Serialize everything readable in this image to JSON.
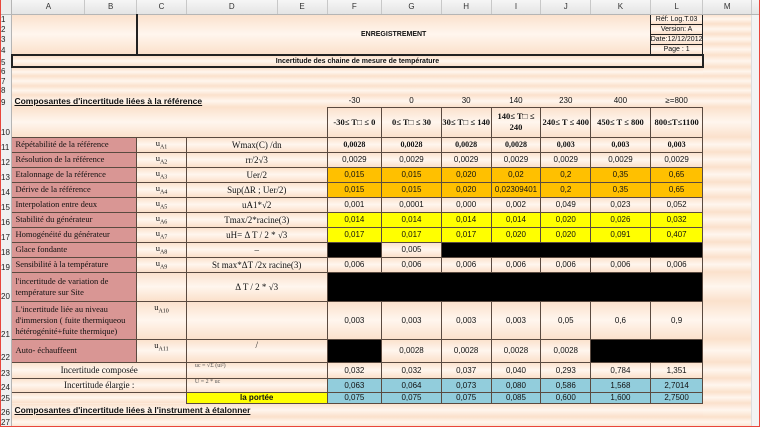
{
  "columns": [
    "A",
    "B",
    "C",
    "D",
    "E",
    "F",
    "G",
    "H",
    "I",
    "J",
    "K",
    "L",
    "M"
  ],
  "header": {
    "title": "ENREGISTREMENT",
    "subtitle": "Incertitude des chaine de mesure de température",
    "ref": "Réf: Log.T.03",
    "version": "Version: A",
    "date": "Date:12/12/2012",
    "page": "Page : 1"
  },
  "section1_title": "Composantes d'incertitude liées à la référence",
  "section2_title": "Composantes d'incertitude liées à l'instrument à étalonner",
  "temps": [
    "-30",
    "0",
    "30",
    "140",
    "230",
    "400",
    "≥=800"
  ],
  "ranges": [
    "-30≤ T□ ≤ 0",
    "0≤ T□ ≤ 30",
    "30≤ T□ ≤ 140",
    "140≤ T□ ≤ 240",
    "240≤ T ≤ 400",
    "450≤ T ≤ 800",
    "800≤T≤1100"
  ],
  "rows": [
    {
      "num": 11,
      "label": "Répétabilité de la référence",
      "symbol": "uA1",
      "formula": "Wmax(C) /dn",
      "fill": "",
      "bold": true,
      "values": [
        "0,0028",
        "0,0028",
        "0,0028",
        "0,0028",
        "0,003",
        "0,003",
        "0,003"
      ]
    },
    {
      "num": 12,
      "label": "Résolution de la  référence",
      "symbol": "uA2",
      "formula": "rr/2√3",
      "fill": "",
      "values": [
        "0,0029",
        "0,0029",
        "0,0029",
        "0,0029",
        "0,0029",
        "0,0029",
        "0,0029"
      ]
    },
    {
      "num": 13,
      "label": "Etalonnage de la référence",
      "symbol": "uA3",
      "formula": "Uer/2",
      "fill": "orange",
      "values": [
        "0,015",
        "0,015",
        "0,020",
        "0,02",
        "0,2",
        "0,35",
        "0,65"
      ]
    },
    {
      "num": 14,
      "label": "Dérive de la référence",
      "symbol": "uA4",
      "formula": "Sup(ΔR ; Uer/2)",
      "fill": "orange",
      "values": [
        "0,015",
        "0,015",
        "0,020",
        "0,02309401",
        "0,2",
        "0,35",
        "0,65"
      ]
    },
    {
      "num": 15,
      "label": "Interpolation entre deux",
      "symbol": "uA5",
      "formula": "uA1*√2",
      "fill": "",
      "values": [
        "0,001",
        "0,0001",
        "0,000",
        "0,002",
        "0,049",
        "0,023",
        "0,052"
      ]
    },
    {
      "num": 16,
      "label": "Stabilité du générateur",
      "symbol": "uA6",
      "formula": "Tmax/2*racine(3)",
      "fill": "yellow",
      "values": [
        "0,014",
        "0,014",
        "0,014",
        "0,014",
        "0,020",
        "0,026",
        "0,032"
      ]
    },
    {
      "num": 17,
      "label": "Homogénéité du générateur",
      "symbol": "uA7",
      "formula": "uH= Δ T / 2 * √3",
      "fill": "yellow",
      "values": [
        "0,017",
        "0,017",
        "0,017",
        "0,020",
        "0,020",
        "0,091",
        "0,407"
      ]
    },
    {
      "num": 18,
      "label": "Glace fondante",
      "symbol": "uA8",
      "formula": "–",
      "fill": "",
      "values": [
        null,
        "0,005",
        null,
        null,
        null,
        null,
        null
      ]
    },
    {
      "num": 19,
      "label": "Sensibilité à la température",
      "symbol": "uA9",
      "formula": "St max*ΔT /2x racine(3)",
      "fill": "",
      "values": [
        "0,006",
        "0,006",
        "0,006",
        "0,006",
        "0,006",
        "0,006",
        "0,006"
      ]
    },
    {
      "num": 20,
      "label": "l'incertitude de  variation de température sur Site",
      "symbol": "",
      "formula": "Δ T / 2 * √3",
      "fill": "",
      "values": [
        null,
        null,
        null,
        null,
        null,
        null,
        null
      ]
    },
    {
      "num": 21,
      "label": "L'incertitude liée au niveau d'immersion ( fuite thermiqueou hétérogénité+fuite thermique)",
      "symbol": "uA10",
      "formula": "",
      "fill": "",
      "values": [
        "0,003",
        "0,003",
        "0,003",
        "0,003",
        "0,05",
        "0,6",
        "0,9"
      ]
    },
    {
      "num": 22,
      "label": "Auto- échauffeent",
      "symbol": "uA11",
      "formula": "/",
      "fill": "",
      "values": [
        null,
        "0,0028",
        "0,0028",
        "0,0028",
        "0,0028",
        null,
        null
      ]
    }
  ],
  "totals": [
    {
      "num": 23,
      "label": "Incertitude composée",
      "formula": "uc = √Σ (ui²)",
      "fill": "",
      "values": [
        "0,032",
        "0,032",
        "0,037",
        "0,040",
        "0,293",
        "0,784",
        "1,351"
      ]
    },
    {
      "num": 24,
      "label": "Incertitude élargie :",
      "formula": "U = 2 * uc",
      "fill": "blue",
      "values": [
        "0,063",
        "0,064",
        "0,073",
        "0,080",
        "0,586",
        "1,568",
        "2,7014"
      ]
    },
    {
      "num": 25,
      "label": "",
      "formula": "la portée",
      "fill": "blue",
      "values": [
        "0,075",
        "0,075",
        "0,075",
        "0,085",
        "0,600",
        "1,600",
        "2,7500"
      ]
    }
  ],
  "colors": {
    "label": "#d99694",
    "orange": "#ffc000",
    "yellow": "#ffff00",
    "blue": "#92cddc"
  }
}
